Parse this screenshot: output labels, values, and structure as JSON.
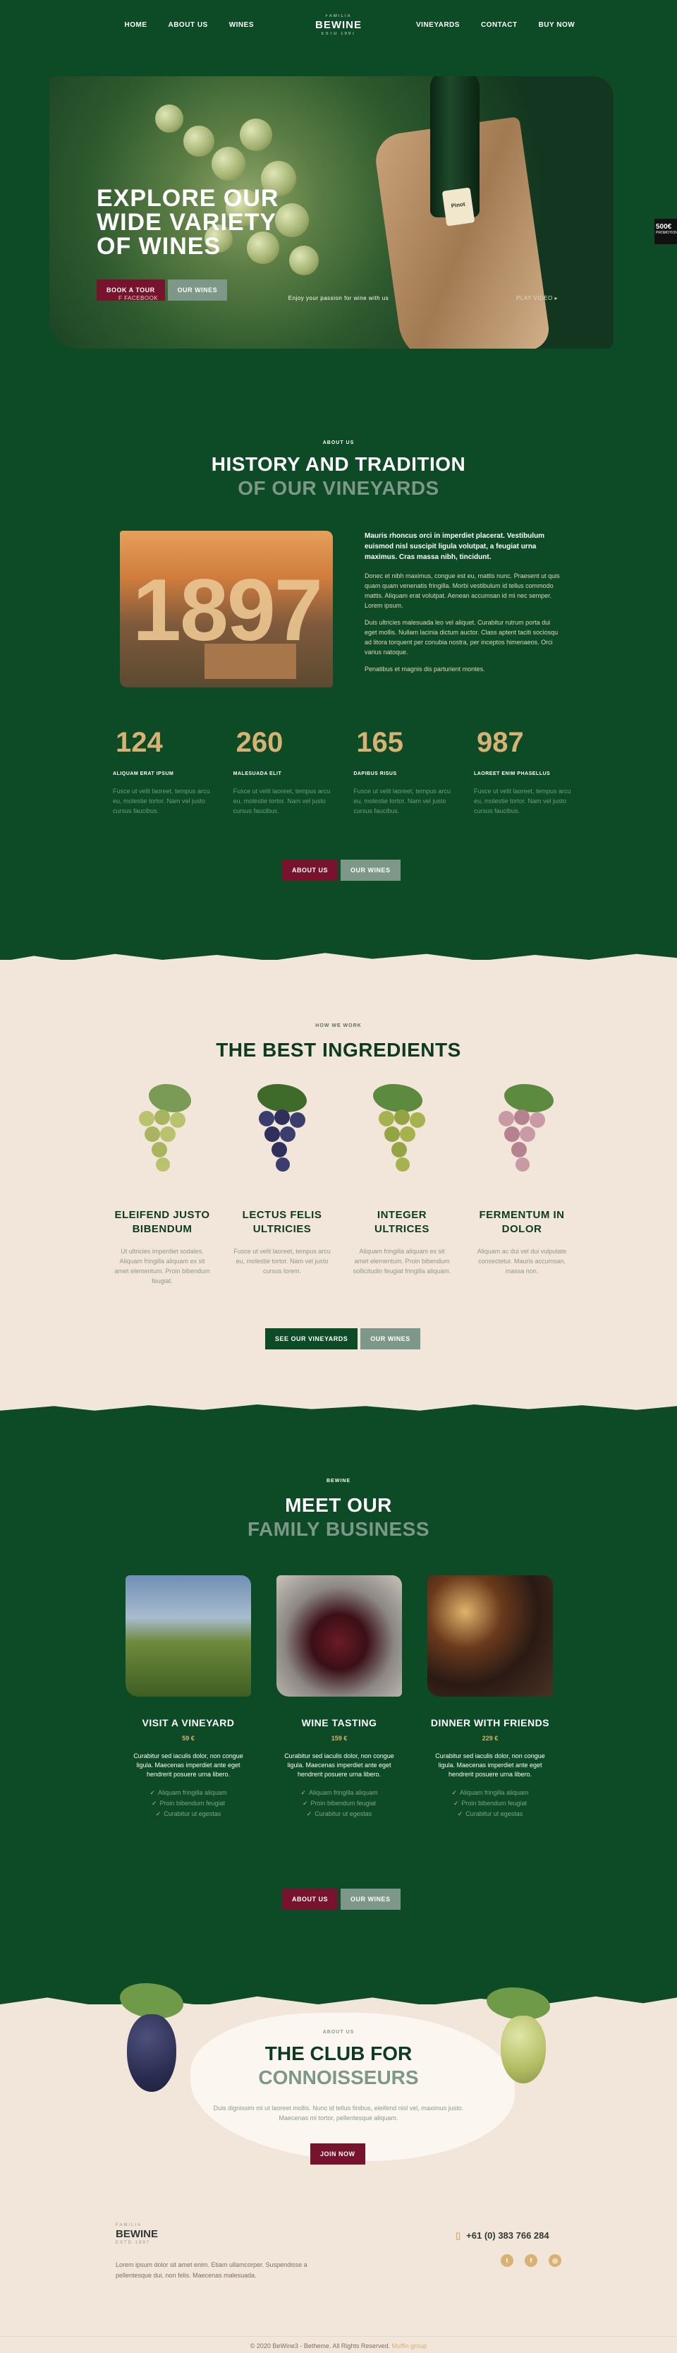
{
  "header": {
    "nav_left": [
      "HOME",
      "ABOUT US",
      "WINES"
    ],
    "nav_right": [
      "VINEYARDS",
      "CONTACT",
      "BUY NOW"
    ],
    "logo_pre": "FAMILIA",
    "logo_name": "BEWINE",
    "logo_post": "ESTD 1997"
  },
  "hero": {
    "title": "EXPLORE OUR WIDE VARIETY OF WINES",
    "btn_tour": "BOOK A TOUR",
    "btn_wines": "OUR WINES",
    "bottle_label": "Pinot",
    "side_badge_num": "500€",
    "side_badge_text": "PROMOTION",
    "bottom_left": "F FACEBOOK",
    "bottom_center": "Enjoy your passion for wine with us",
    "bottom_right": "PLAY VIDEO ▸"
  },
  "history": {
    "small": "ABOUT US",
    "title": "HISTORY AND TRADITION",
    "subtitle": "OF OUR VINEYARDS",
    "year": "1897",
    "lead": "Mauris rhoncus orci in imperdiet placerat. Vestibulum euismod nisl suscipit ligula volutpat, a feugiat urna maximus. Cras massa nibh, tincidunt.",
    "p1": "Donec et nibh maximus, congue est eu, mattis nunc. Praesent ut quis quam quam venenatis fringilla. Morbi vestibulum id tellus commodo mattis. Aliquam erat volutpat. Aenean accumsan id mi nec semper. Lorem ipsum.",
    "p2": "Duis ultricies malesuada leo vel aliquet. Curabitur rutrum porta dui eget mollis. Nullam lacinia dictum auctor. Class aptent taciti sociosqu ad litora torquent per conubia nostra, per inceptos himenaeos. Orci varius natoque.",
    "p3": "Penatibus et magnis dis parturient montes.",
    "stats": [
      {
        "num": "124",
        "label": "ALIQUAM ERAT IPSUM",
        "desc": "Fusce ut velit laoreet, tempus arcu eu, molestie tortor. Nam vel justo cursus faucibus."
      },
      {
        "num": "260",
        "label": "MALESUADA ELIT",
        "desc": "Fusce ut velit laoreet, tempus arcu eu, molestie tortor. Nam vel justo cursus faucibus."
      },
      {
        "num": "165",
        "label": "DAPIBUS RISUS",
        "desc": "Fusce ut velit laoreet, tempus arcu eu, molestie tortor. Nam vel justo cursus faucibus."
      },
      {
        "num": "987",
        "label": "LAOREET ENIM PHASELLUS",
        "desc": "Fusce ut velit laoreet, tempus arcu eu, molestie tortor. Nam vel justo cursus faucibus."
      }
    ],
    "btn_about": "ABOUT US",
    "btn_wines": "OUR WINES"
  },
  "ingredients": {
    "small": "HOW WE WORK",
    "title": "THE BEST INGREDIENTS",
    "items": [
      {
        "title": "ELEIFEND JUSTO BIBENDUM",
        "desc": "Ut ultricies imperdiet sodales. Aliquam fringilla aliquam ex sit amet elementum. Proin bibendum feugiat."
      },
      {
        "title": "LECTUS FELIS ULTRICIES",
        "desc": "Fusce ut velit laoreet, tempus arcu eu, molestie tortor. Nam vel justo cursus lorem."
      },
      {
        "title": "INTEGER ULTRICES",
        "desc": "Aliquam fringilla aliquam ex sit amet elementum. Proin bibendum sollicitudin feugiat fringilla aliquam."
      },
      {
        "title": "FERMENTUM IN DOLOR",
        "desc": "Aliquam ac dui vel dui vulputate consectetur. Mauris accumsan, massa non."
      }
    ],
    "btn_vineyards": "SEE OUR VINEYARDS",
    "btn_wines": "OUR WINES"
  },
  "family": {
    "small": "BEWINE",
    "title": "MEET OUR",
    "subtitle": "FAMILY BUSINESS",
    "items": [
      {
        "title": "VISIT A VINEYARD",
        "price": "59 €",
        "desc": "Curabitur sed iaculis dolor, non congue ligula. Maecenas imperdiet ante eget hendrerit posuere urna libero.",
        "features": [
          "Aliquam fringilla aliquam",
          "Proin bibendum feugiat",
          "Curabitur ut egestas"
        ]
      },
      {
        "title": "WINE TASTING",
        "price": "159 €",
        "desc": "Curabitur sed iaculis dolor, non congue ligula. Maecenas imperdiet ante eget hendrerit posuere urna libero.",
        "features": [
          "Aliquam fringilla aliquam",
          "Proin bibendum feugiat",
          "Curabitur ut egestas"
        ]
      },
      {
        "title": "DINNER WITH FRIENDS",
        "price": "229 €",
        "desc": "Curabitur sed iaculis dolor, non congue ligula. Maecenas imperdiet ante eget hendrerit posuere urna libero.",
        "features": [
          "Aliquam fringilla aliquam",
          "Proin bibendum feugiat",
          "Curabitur ut egestas"
        ]
      }
    ],
    "btn_about": "ABOUT US",
    "btn_wines": "OUR WINES"
  },
  "club": {
    "small": "ABOUT US",
    "title": "THE CLUB FOR",
    "subtitle": "CONNOISSEURS",
    "desc": "Duis dignissim mi ut laoreet mollis. Nunc id tellus finibus, eleifend nisl vel, maximus justo. Maecenas mi tortor, pellentesque aliquam.",
    "btn_join": "JOIN NOW"
  },
  "footer": {
    "logo_pre": "FAMILIA",
    "logo_name": "BEWINE",
    "logo_post": "ESTD 1997",
    "text": "Lorem ipsum dolor sit amet enim. Etiam ullamcorper. Suspendisse a pellentesque dui, non felis. Maecenas malesuada.",
    "phone": "+61 (0) 383 766 284",
    "copyright": "© 2020 BeWine3 - Betheme. All Rights Reserved.",
    "copyright_link": "Muffin group"
  }
}
